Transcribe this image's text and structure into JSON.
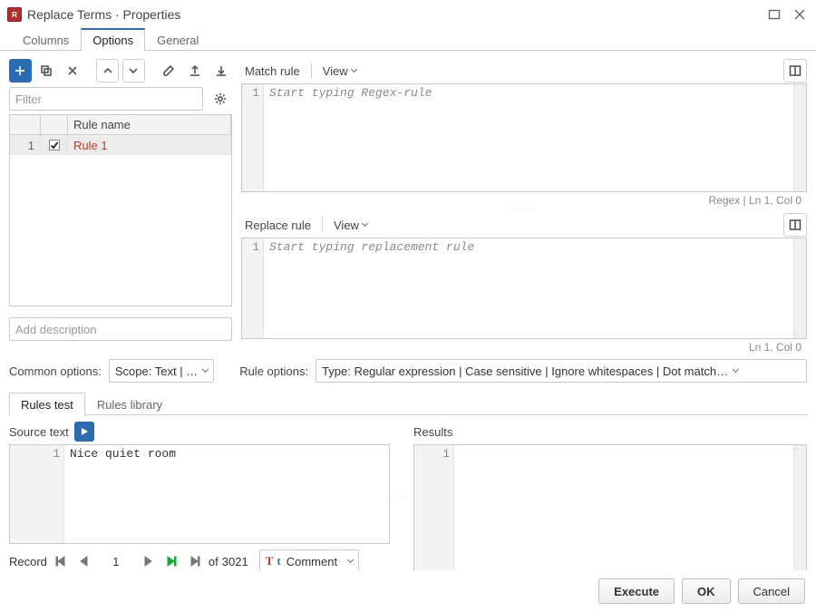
{
  "window": {
    "title": "Replace Terms · Properties"
  },
  "tabs": {
    "columns": "Columns",
    "options": "Options",
    "general": "General"
  },
  "left": {
    "filter_placeholder": "Filter",
    "grid_header": "Rule name",
    "rows": [
      {
        "idx": "1",
        "checked": true,
        "name": "Rule 1"
      }
    ],
    "desc_placeholder": "Add description"
  },
  "editors": {
    "match_label": "Match rule",
    "view_label": "View",
    "match_placeholder": "Start typing Regex-rule",
    "match_status": "Regex | Ln 1, Col 0",
    "replace_label": "Replace rule",
    "replace_placeholder": "Start typing replacement rule",
    "replace_status": "Ln 1, Col 0",
    "gutter1": "1"
  },
  "options": {
    "common_label": "Common options:",
    "scope_value": "Scope: Text | …",
    "rule_label": "Rule options:",
    "rule_value": "Type: Regular expression | Case sensitive | Ignore whitespaces | Dot match…"
  },
  "subtabs": {
    "rules_test": "Rules test",
    "rules_library": "Rules library"
  },
  "test": {
    "source_label": "Source text",
    "results_label": "Results",
    "source_line1": "Nice quiet room",
    "gutter1": "1"
  },
  "record": {
    "label": "Record",
    "current": "1",
    "of_label": "of",
    "total": "3021",
    "column": "Comment"
  },
  "footer": {
    "execute": "Execute",
    "ok": "OK",
    "cancel": "Cancel"
  }
}
